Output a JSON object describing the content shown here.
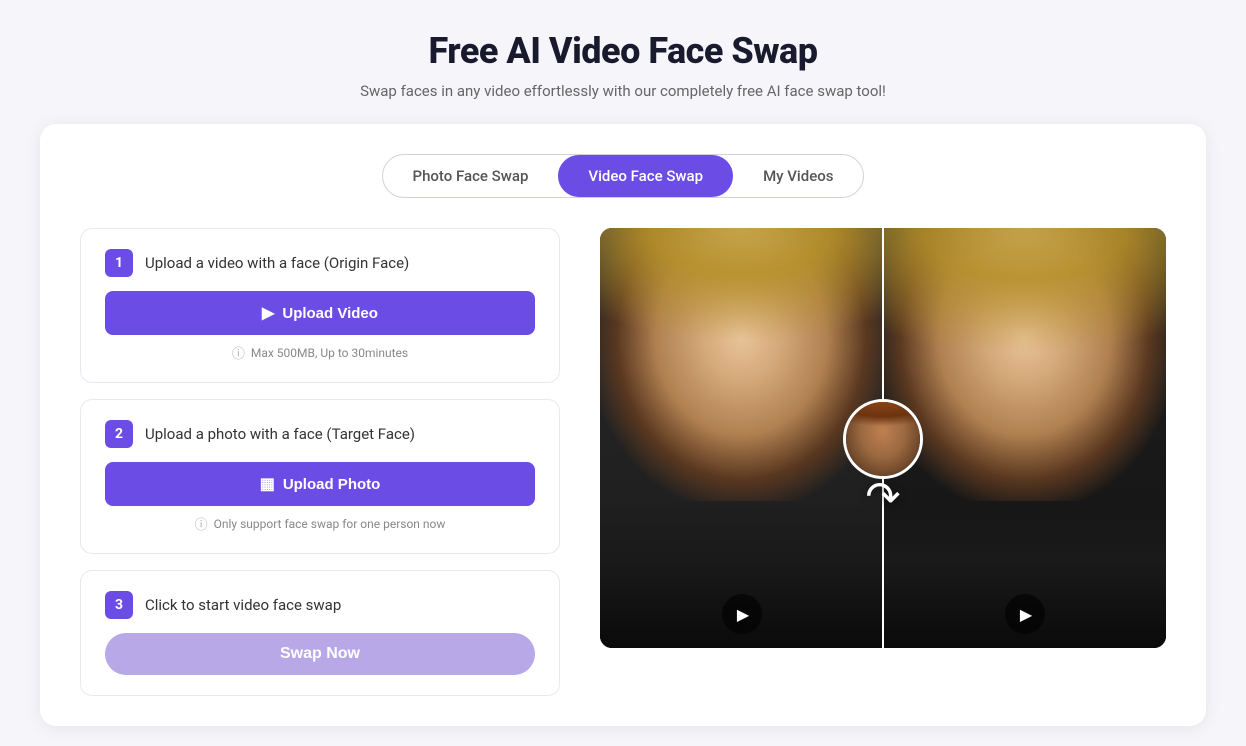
{
  "page": {
    "title": "Free AI Video Face Swap",
    "subtitle": "Swap faces in any video effortlessly with our completely free AI face swap tool!"
  },
  "tabs": {
    "items": [
      {
        "id": "photo-face-swap",
        "label": "Photo Face Swap",
        "active": false
      },
      {
        "id": "video-face-swap",
        "label": "Video Face Swap",
        "active": true
      },
      {
        "id": "my-videos",
        "label": "My Videos",
        "active": false
      }
    ]
  },
  "steps": [
    {
      "number": "1",
      "description": "Upload a video with a face  (Origin Face)",
      "button_label": "Upload Video",
      "hint": "Max 500MB, Up to 30minutes",
      "hint_type": "info"
    },
    {
      "number": "2",
      "description": "Upload a photo with a face  (Target Face)",
      "button_label": "Upload Photo",
      "hint": "Only support face swap for one person now",
      "hint_type": "info"
    },
    {
      "number": "3",
      "description": "Click to start video face swap",
      "button_label": "Swap Now",
      "hint": "",
      "hint_type": "none"
    }
  ],
  "colors": {
    "primary": "#6b4de6",
    "primary_disabled": "#b8a8e8",
    "border": "#e8e8f0",
    "text_dark": "#1a1a2e",
    "text_medium": "#333",
    "text_light": "#666",
    "text_hint": "#888"
  },
  "icons": {
    "upload_video": "▶",
    "upload_photo": "⊞",
    "play": "▶",
    "info": "ⓘ",
    "arrow_swap": "↷"
  }
}
